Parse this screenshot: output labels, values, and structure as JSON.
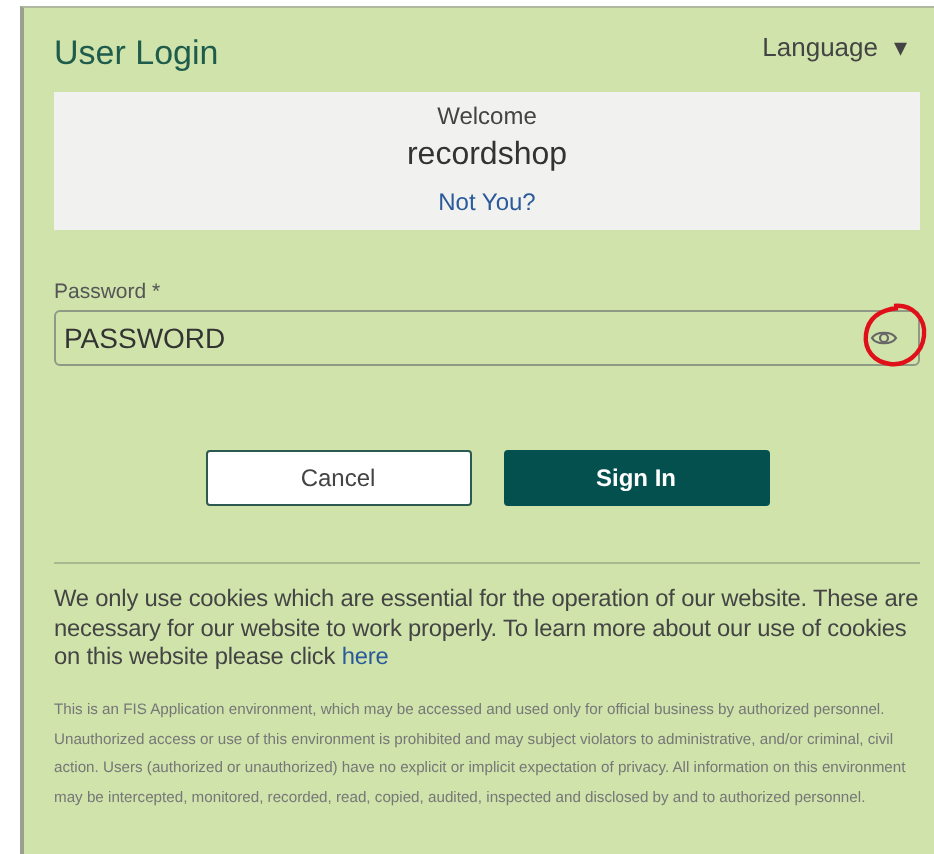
{
  "title": "User Login",
  "language_menu": {
    "label": "Language",
    "caret": "▾"
  },
  "welcome": {
    "greeting": "Welcome",
    "username": "recordshop",
    "link": "Not You?"
  },
  "password": {
    "label": "Password *",
    "value": "PASSWORD",
    "annotation": {
      "kind": "circle",
      "color": "#e0101a"
    }
  },
  "buttons": [
    {
      "label": "Cancel",
      "kind": "secondary"
    },
    {
      "label": "Sign In",
      "kind": "primary"
    }
  ],
  "cookie_notice": {
    "text": "We only use cookies which are essential for the operation of our website. These are necessary for our website to work properly. To learn more about our use of cookies on this website please click",
    "link": "here"
  },
  "legal_notice": "This is an FIS Application environment, which may be accessed and used only for official business by authorized personnel. Unauthorized access or use of this environment is prohibited and may subject violators to administrative, and/or criminal, civil action. Users (authorized or unauthorized) have no explicit or implicit expectation of privacy. All information on this environment may be intercepted, monitored, recorded, read, copied, audited, inspected and disclosed by and to authorized personnel."
}
